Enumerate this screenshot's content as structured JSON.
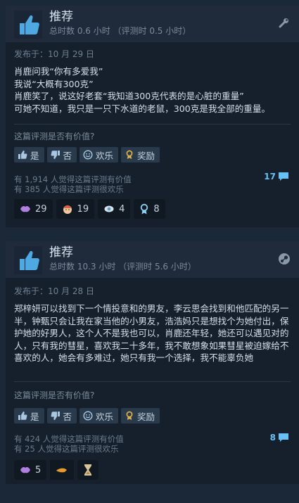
{
  "reviews": [
    {
      "recommendation": "推荐",
      "hours": "总时数 0.6 小时 （评测时 0.5 小时）",
      "posted": "发布于：10 月 29 日",
      "text": "肖鹿问我“你有多爱我”\n我说“大概有300克”\n肖鹿笑了，说这好老套“我知道300克代表的是心脏的重量”\n可她不知道，我只是一只下水道的老鼠，300克是我全部的重量。",
      "helpful_question": "这篇评测是否有价值?",
      "buttons": {
        "yes": "是",
        "no": "否",
        "funny": "欢乐",
        "award": "奖励"
      },
      "helpful_count": "有 1,914 人觉得这篇评测有价值",
      "funny_count": "有 385 人觉得这篇评测很欢乐",
      "comment_count": "17",
      "awards": [
        {
          "icon": "purple-lips-icon",
          "count": "29"
        },
        {
          "icon": "face-icon",
          "count": "19"
        },
        {
          "icon": "eye-icon",
          "count": "4"
        },
        {
          "icon": "medal-icon",
          "count": "8"
        }
      ]
    },
    {
      "recommendation": "推荐",
      "hours": "总时数 10.3 小时 （评测时 5.6 小时）",
      "posted": "发布于：10 月 28 日",
      "text": "郑梓妍可以找到下一个情投意和的男友，李云思会找到和他匹配的另一半，钟甄只会让我在家当他的小男友，浩浩妈只是想找个为她付出，保护她的好男人，这个人不是我也可以，肖鹿还年轻，她还可以遇见对的人，只有我的彗星，喜欢我二十多年，我不敢想象如果彗星被迫嫁给不喜欢的人，她会有多难过，她只有我一个选择，我不能辜负她",
      "helpful_question": "这篇评测是否有价值?",
      "buttons": {
        "yes": "是",
        "no": "否",
        "funny": "欢乐",
        "award": "奖励"
      },
      "helpful_count": "有 424 人觉得这篇评测有价值",
      "funny_count": "有 25 人觉得这篇评测很欢乐",
      "comment_count": "8",
      "awards": [
        {
          "icon": "purple-lips-icon",
          "count": "5"
        },
        {
          "icon": "hand-icon",
          "count": ""
        },
        {
          "icon": "hourglass-icon",
          "count": ""
        }
      ]
    }
  ]
}
